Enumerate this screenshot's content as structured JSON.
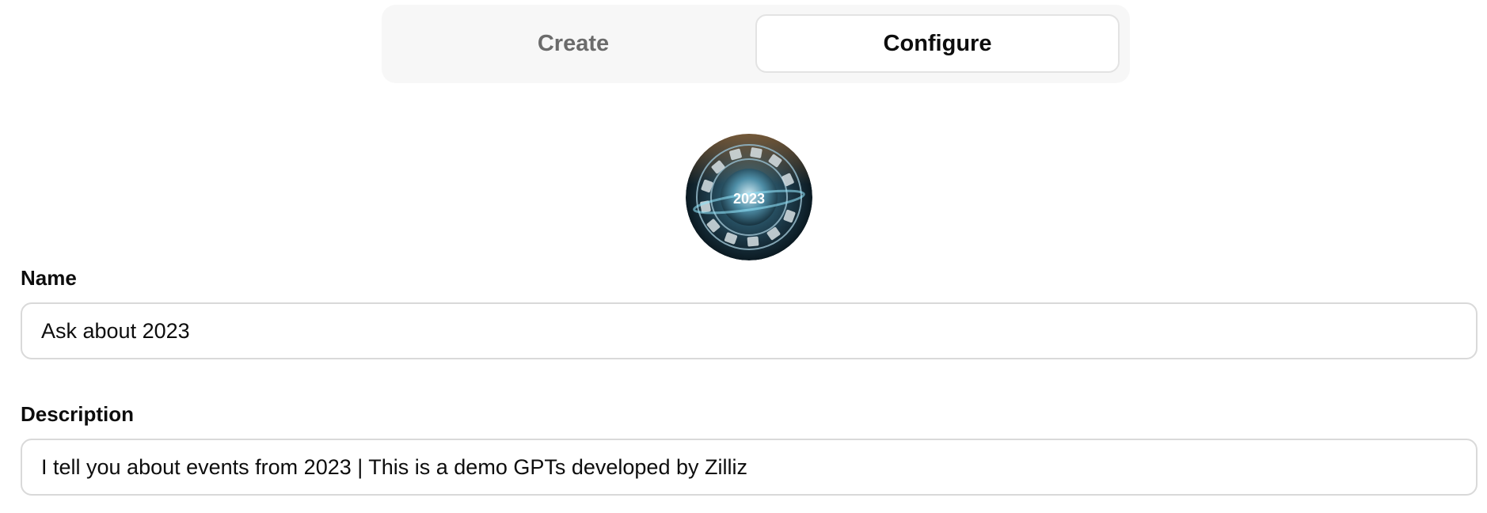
{
  "tabs": {
    "create_label": "Create",
    "configure_label": "Configure",
    "active": "Configure"
  },
  "avatar": {
    "image_text": "2023"
  },
  "form": {
    "name_label": "Name",
    "name_value": "Ask about 2023",
    "description_label": "Description",
    "description_value": "I tell you about events from 2023 | This is a demo GPTs developed by Zilliz"
  },
  "colors": {
    "tab_bar_bg": "#f7f7f7",
    "inactive_tab_text": "#6b6b6b",
    "active_tab_border": "#e3e3e3",
    "field_border": "#d9d9d9",
    "text": "#0d0d0d"
  }
}
